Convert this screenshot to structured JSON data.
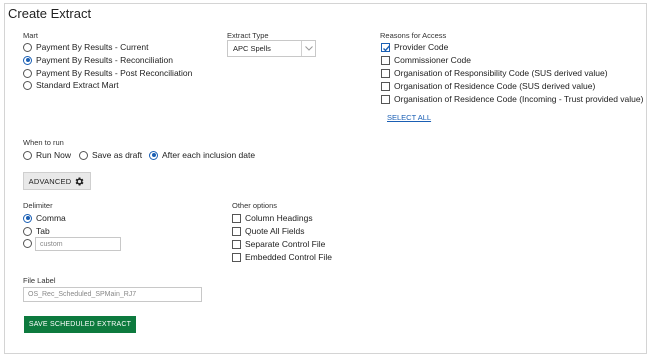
{
  "title": "Create Extract",
  "mart": {
    "label": "Mart",
    "options": [
      {
        "label": "Payment By Results - Current",
        "selected": false
      },
      {
        "label": "Payment By Results - Reconciliation",
        "selected": true
      },
      {
        "label": "Payment By Results - Post Reconciliation",
        "selected": false
      },
      {
        "label": "Standard Extract Mart",
        "selected": false
      }
    ]
  },
  "extract_type": {
    "label": "Extract Type",
    "value": "APC Spells"
  },
  "reasons": {
    "label": "Reasons for Access",
    "options": [
      {
        "label": "Provider Code",
        "checked": true
      },
      {
        "label": "Commissioner Code",
        "checked": false
      },
      {
        "label": "Organisation of Responsibility Code (SUS derived value)",
        "checked": false
      },
      {
        "label": "Organisation of Residence Code (SUS derived value)",
        "checked": false
      },
      {
        "label": "Organisation of Residence Code (Incoming - Trust provided value)",
        "checked": false
      }
    ],
    "select_all": "SELECT ALL"
  },
  "when_to_run": {
    "label": "When to run",
    "options": [
      {
        "label": "Run Now",
        "selected": false
      },
      {
        "label": "Save as draft",
        "selected": false
      },
      {
        "label": "After each inclusion date",
        "selected": true
      }
    ]
  },
  "advanced_button": "ADVANCED",
  "delimiter": {
    "label": "Delimiter",
    "options": [
      {
        "label": "Comma",
        "selected": true
      },
      {
        "label": "Tab",
        "selected": false
      }
    ],
    "custom_placeholder": "custom"
  },
  "other_options": {
    "label": "Other options",
    "options": [
      {
        "label": "Column Headings",
        "checked": false
      },
      {
        "label": "Quote All Fields",
        "checked": false
      },
      {
        "label": "Separate Control File",
        "checked": false
      },
      {
        "label": "Embedded Control File",
        "checked": false
      }
    ]
  },
  "file_label": {
    "label": "File Label",
    "value": "OS_Rec_Scheduled_SPMain_RJ7"
  },
  "save_button": "SAVE SCHEDULED EXTRACT",
  "colors": {
    "accent": "#1a5fb4",
    "save_button": "#0d7a3e"
  }
}
